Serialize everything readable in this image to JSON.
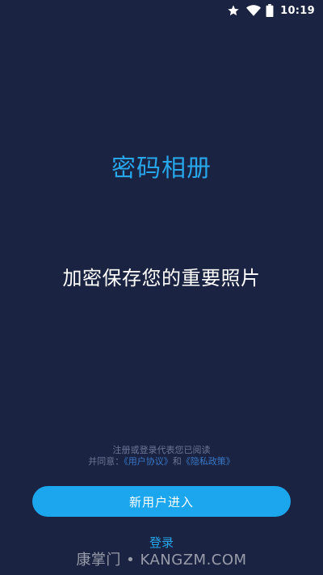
{
  "status_bar": {
    "time": "10:19",
    "icons": [
      "star-icon",
      "wifi-icon",
      "battery-icon"
    ]
  },
  "app": {
    "title": "密码相册",
    "slogan": "加密保存您的重要照片"
  },
  "agreement": {
    "line1": "注册或登录代表您已阅读",
    "line2_prefix": "并同意：",
    "user_agreement_label": "《用户协议》",
    "conjunction": "和",
    "privacy_policy_label": "《隐私政策》"
  },
  "actions": {
    "new_user_label": "新用户进入",
    "login_label": "登录"
  },
  "watermark": {
    "text": "康掌门 • KANGZM.COM"
  },
  "colors": {
    "background": "#1a2341",
    "accent": "#27a6ea",
    "button": "#1ca6ee",
    "link": "#3a78c8",
    "muted_text": "#6d7696"
  }
}
